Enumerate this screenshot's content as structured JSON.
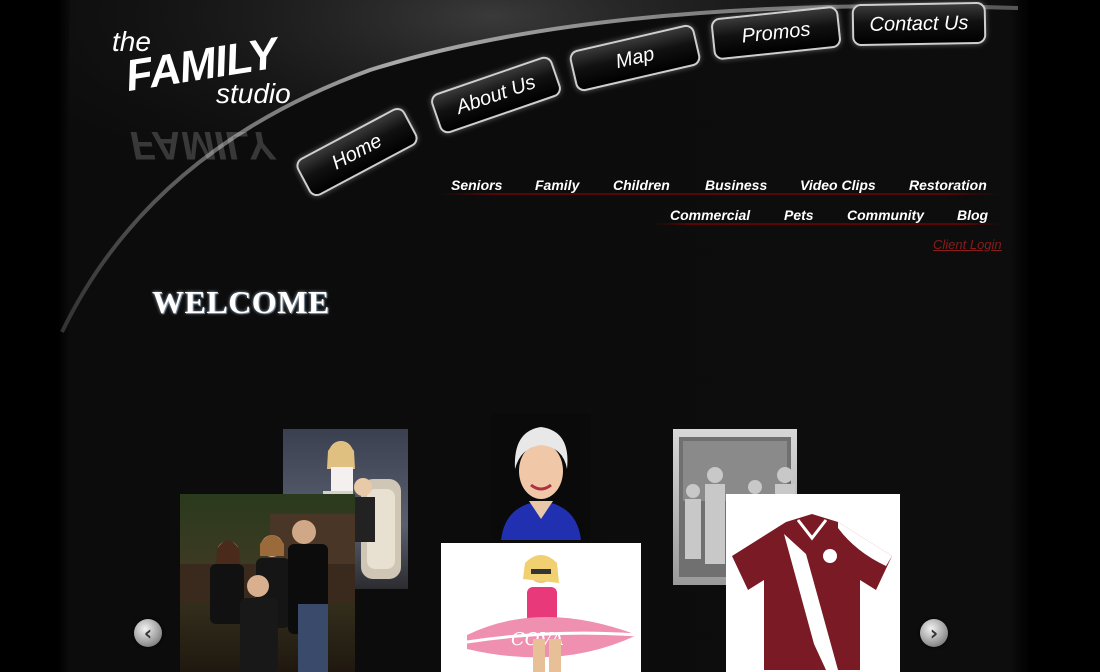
{
  "logo": {
    "the": "the",
    "family": "FAMILY",
    "studio": "studio"
  },
  "main_nav": [
    {
      "label": "Home"
    },
    {
      "label": "About Us"
    },
    {
      "label": "Map"
    },
    {
      "label": "Promos"
    },
    {
      "label": "Contact Us"
    }
  ],
  "sub_nav_row1": [
    "Seniors",
    "Family",
    "Children",
    "Business",
    "Video Clips",
    "Restoration"
  ],
  "sub_nav_row2": [
    "Commercial",
    "Pets",
    "Community",
    "Blog"
  ],
  "client_login": "Client Login",
  "welcome": "WELCOME",
  "gallery": {
    "photos": [
      {
        "name": "family-portrait-photo",
        "subject": "family"
      },
      {
        "name": "children-portrait-photo",
        "subject": "children"
      },
      {
        "name": "business-headshot-photo",
        "subject": "business"
      },
      {
        "name": "surfboard-promo-photo",
        "subject": "commercial"
      },
      {
        "name": "vintage-restoration-photo",
        "subject": "restoration"
      },
      {
        "name": "polo-shirt-product-photo",
        "subject": "product"
      }
    ],
    "prev_icon": "chevron-left-icon",
    "next_icon": "chevron-right-icon"
  },
  "colors": {
    "background": "#0c0c0c",
    "accent_red": "#5a0505",
    "login_red": "#8a1c1c",
    "polo_maroon": "#7a1a24"
  }
}
